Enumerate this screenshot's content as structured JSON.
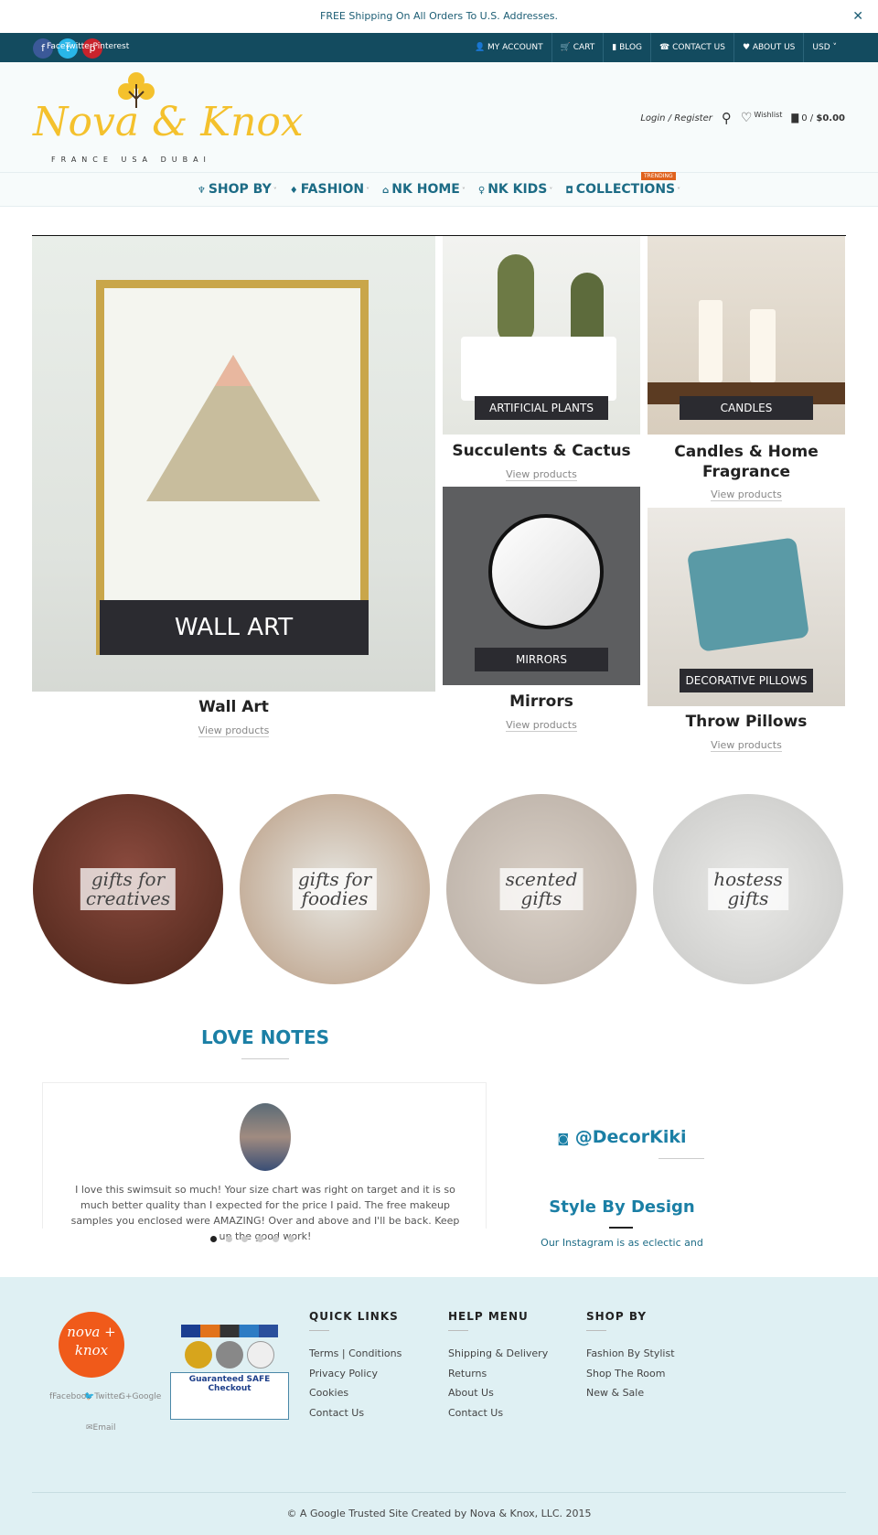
{
  "promo": {
    "text": "FREE Shipping On All Orders To U.S. Addresses.",
    "close": "✕"
  },
  "topbar": {
    "social": [
      "Facebook",
      "Twitter",
      "Pinterest"
    ],
    "social_overlap_label": "FaceTwitterPinterest",
    "links": [
      "MY ACCOUNT",
      "CART",
      "BLOG",
      "CONTACT US",
      "ABOUT US",
      "USD"
    ]
  },
  "header": {
    "logo": "Nova & Knox",
    "logo_sub": "FRANCE USA DUBAI",
    "login": "Login / Register",
    "wishlist": "Wishlist",
    "cart": "0 / ",
    "cart_total": "$0.00"
  },
  "nav": {
    "items": [
      "SHOP BY",
      "FASHION",
      "NK HOME",
      "NK KIDS",
      "COLLECTIONS"
    ],
    "badge": "TRENDING"
  },
  "categories": [
    {
      "title": "Wall Art",
      "label": "WALL ART",
      "link": "View products"
    },
    {
      "title": "Succulents & Cactus",
      "label": "ARTIFICIAL PLANTS",
      "link": "View products"
    },
    {
      "title": "Mirrors",
      "label": "MIRRORS",
      "link": "View products"
    },
    {
      "title": "Candles & Home Fragrance",
      "label": "CANDLES",
      "link": "View products"
    },
    {
      "title": "Throw Pillows",
      "label": "DECORATIVE PILLOWS",
      "link": "View products"
    }
  ],
  "gifts": [
    {
      "l1": "gifts for",
      "l2": "creatives"
    },
    {
      "l1": "gifts for",
      "l2": "foodies"
    },
    {
      "l1": "scented",
      "l2": "gifts"
    },
    {
      "l1": "hostess",
      "l2": "gifts"
    }
  ],
  "love_notes": {
    "heading": "LOVE NOTES",
    "quote": "I love this swimsuit so much! Your size chart was right on target and it is so much better quality than I expected for the price I paid. The free makeup samples you enclosed were AMAZING! Over and above and I'll be back. Keep up the good work!",
    "slides": 6,
    "active_slide": 1
  },
  "instagram": {
    "handle": "@DecorKiki",
    "title": "Style By Design",
    "text": "Our Instagram is as eclectic and"
  },
  "footer": {
    "logo": "nova + knox",
    "social": [
      "Facebook",
      "Twitter",
      "Google",
      "Email"
    ],
    "badge_text": "Guaranteed SAFE Checkout",
    "quick_links": {
      "title": "QUICK LINKS",
      "items": [
        "Terms | Conditions",
        "Privacy Policy",
        "Cookies",
        "Contact Us"
      ]
    },
    "help_menu": {
      "title": "HELP MENU",
      "items": [
        "Shipping & Delivery",
        "Returns",
        "About Us",
        "Contact Us"
      ]
    },
    "shop_by": {
      "title": "SHOP BY",
      "items": [
        "Fashion By Stylist",
        "Shop The Room",
        "New & Sale"
      ]
    },
    "copyright": "© A Google Trusted Site Created by Nova & Knox, LLC. 2015"
  },
  "colors": {
    "topbar": "#134b5f",
    "accent": "#1b7fa5",
    "footer": "#dff0f3",
    "logo": "#f4c12d",
    "orange": "#f05a1a"
  }
}
